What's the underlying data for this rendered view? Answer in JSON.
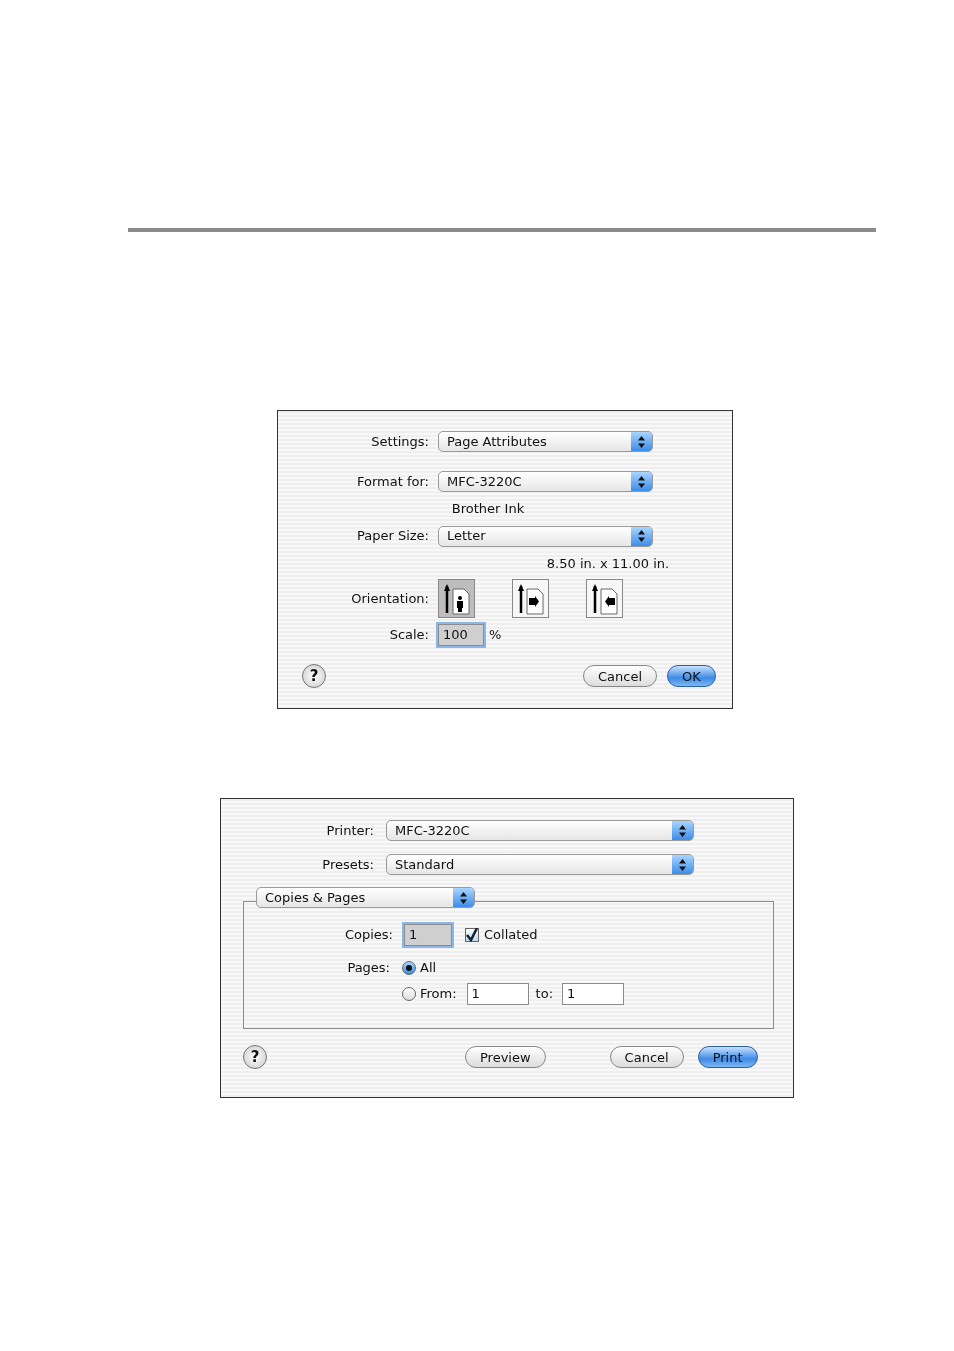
{
  "page_setup": {
    "fields": [
      {
        "label": "Settings:",
        "value": "Page Attributes"
      },
      {
        "label": "Format for:",
        "value": "MFC-3220C",
        "note": "Brother Ink"
      },
      {
        "label": "Paper Size:",
        "value": "Letter",
        "note": "8.50 in. x 11.00 in."
      }
    ],
    "orientation": {
      "label": "Orientation:",
      "options": [
        {
          "kind": "portrait",
          "selected": true
        },
        {
          "kind": "landscape",
          "selected": false
        },
        {
          "kind": "reverse-landscape",
          "selected": false
        }
      ]
    },
    "scale": {
      "label": "Scale:",
      "value": "100",
      "unit": "%"
    },
    "help": "?",
    "buttons": [
      {
        "label": "Cancel",
        "default": false
      },
      {
        "label": "OK",
        "default": true
      }
    ]
  },
  "print": {
    "fields": [
      {
        "label": "Printer:",
        "value": "MFC-3220C"
      },
      {
        "label": "Presets:",
        "value": "Standard"
      }
    ],
    "panel": "Copies & Pages",
    "copies": {
      "label": "Copies:",
      "value": "1"
    },
    "collated": {
      "label": "Collated",
      "checked": true
    },
    "pages": {
      "label": "Pages:",
      "options": [
        {
          "label": "All",
          "selected": true
        },
        {
          "label": "From:",
          "selected": false
        }
      ],
      "from": "1",
      "to_label": "to:",
      "to": "1"
    },
    "help": "?",
    "buttons": [
      {
        "label": "Preview",
        "default": false
      },
      {
        "label": "Cancel",
        "default": false
      },
      {
        "label": "Print",
        "default": true
      }
    ]
  }
}
